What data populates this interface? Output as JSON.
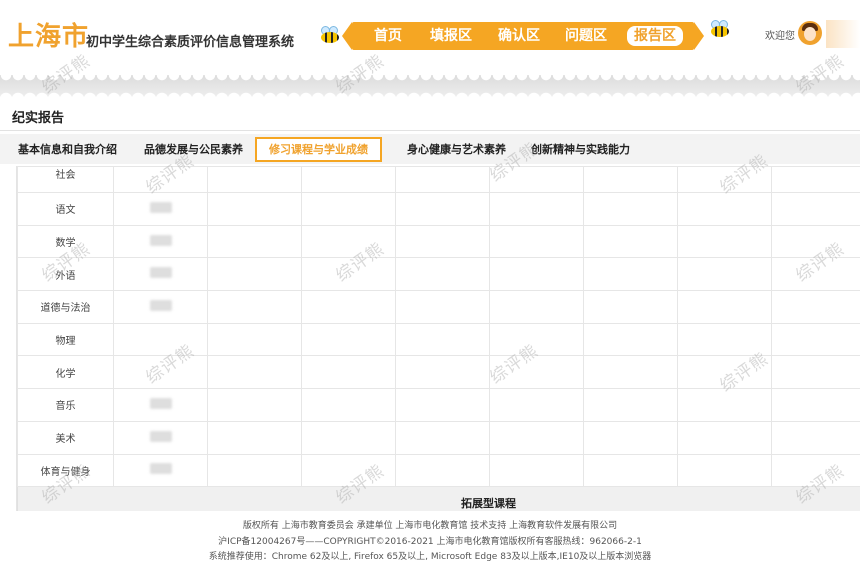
{
  "header": {
    "logo": "上海市",
    "system_title": "初中学生综合素质评价信息管理系统",
    "nav": [
      {
        "label": "首页",
        "active": false
      },
      {
        "label": "填报区",
        "active": false
      },
      {
        "label": "确认区",
        "active": false
      },
      {
        "label": "问题区",
        "active": false
      },
      {
        "label": "报告区",
        "active": true
      }
    ],
    "welcome": "欢迎您",
    "accent_color": "#f5a623"
  },
  "report": {
    "title": "纪实报告",
    "tabs": [
      {
        "label": "基本信息和自我介绍",
        "active": false
      },
      {
        "label": "品德发展与公民素养",
        "active": false
      },
      {
        "label": "修习课程与学业成绩",
        "active": true
      },
      {
        "label": "身心健康与艺术素养",
        "active": false
      },
      {
        "label": "创新精神与实践能力",
        "active": false
      }
    ],
    "subjects": [
      "社会",
      "语文",
      "数学",
      "外语",
      "道德与法治",
      "物理",
      "化学",
      "音乐",
      "美术",
      "体育与健身"
    ],
    "extended_section": "拓展型课程"
  },
  "watermark": "综评熊",
  "footer": {
    "line1": "版权所有 上海市教育委员会    承建单位 上海市电化教育馆    技术支持 上海教育软件发展有限公司",
    "line2": "沪ICP备12004267号——COPYRIGHT©2016-2021 上海市电化教育馆版权所有客服热线：962066-2-1",
    "line3": "系统推荐使用：Chrome 62及以上, Firefox 65及以上, Microsoft Edge 83及以上版本,IE10及以上版本浏览器"
  }
}
